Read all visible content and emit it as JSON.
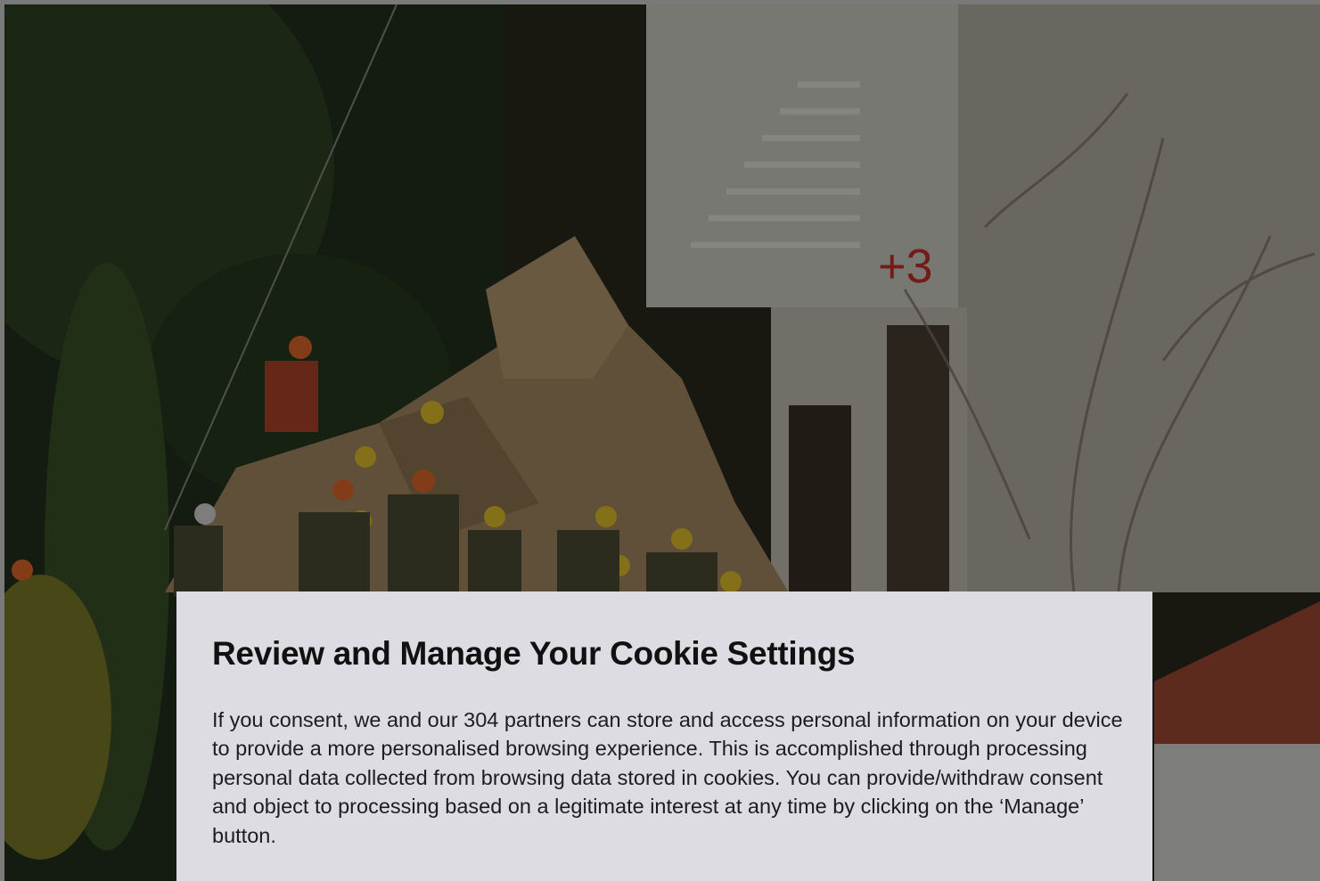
{
  "consent": {
    "title": "Review and Manage Your Cookie Settings",
    "body": "If you consent, we and our 304 partners can store and access personal information on your device to provide a more personalised browsing experience. This is accomplished through processing personal data collected from browsing data stored in cookies. You can provide/withdraw consent and object to processing based on a legitimate interest at any time by clicking on the ‘Manage’ button."
  },
  "hero_image": {
    "graffiti_text": "+3"
  },
  "colors": {
    "modal_bg": "#dcdce2",
    "frame": "#7a7a7a",
    "overlay": "rgba(0,0,0,0.42)"
  }
}
